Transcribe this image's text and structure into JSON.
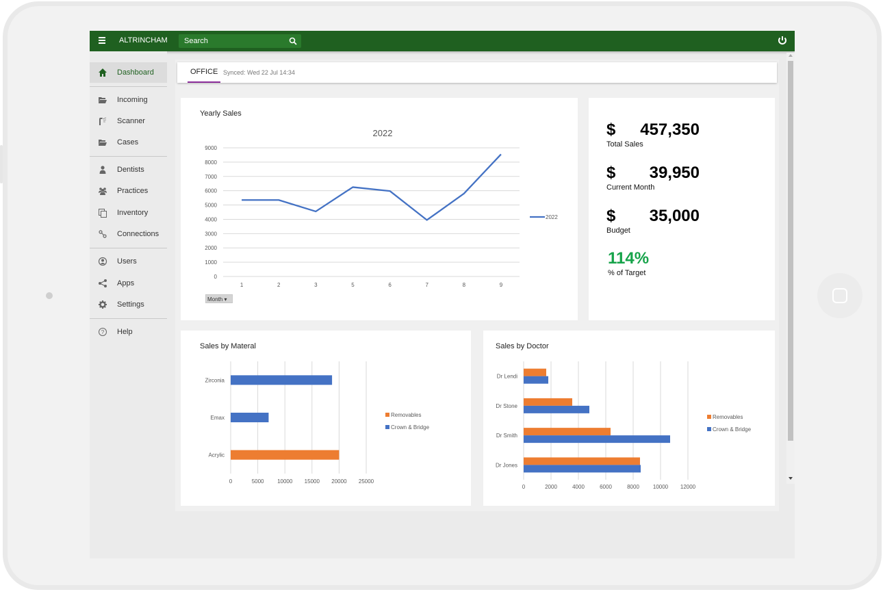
{
  "app": {
    "brand": "ALTRINCHAM",
    "search_placeholder": "Search",
    "icons": {
      "menu": "hamburger-icon",
      "search": "search-icon",
      "power": "power-icon"
    }
  },
  "sidebar": {
    "items": [
      {
        "label": "Dashboard",
        "icon": "home-icon",
        "active": true
      },
      {
        "label": "Incoming",
        "icon": "folder-open-icon"
      },
      {
        "label": "Scanner",
        "icon": "scanner-icon"
      },
      {
        "label": "Cases",
        "icon": "folder-open-icon"
      },
      {
        "label": "Dentists",
        "icon": "user-icon"
      },
      {
        "label": "Practices",
        "icon": "users-icon"
      },
      {
        "label": "Inventory",
        "icon": "copy-icon"
      },
      {
        "label": "Connections",
        "icon": "link-icon"
      },
      {
        "label": "Users",
        "icon": "user-circle-icon"
      },
      {
        "label": "Apps",
        "icon": "share-icon"
      },
      {
        "label": "Settings",
        "icon": "gear-icon"
      },
      {
        "label": "Help",
        "icon": "question-circle-icon"
      }
    ]
  },
  "tabbar": {
    "tab": "OFFICE",
    "synced": "Synced: Wed 22 Jul 14:34"
  },
  "kpis": {
    "currency": "$",
    "total_sales": {
      "value": "457,350",
      "label": "Total Sales"
    },
    "current_month": {
      "value": "39,950",
      "label": "Current Month"
    },
    "budget": {
      "value": "35,000",
      "label": "Budget"
    },
    "target": {
      "value": "114%",
      "label": "% of Target"
    }
  },
  "colors": {
    "brand_green": "#1f6020",
    "series_blue": "#4472c4",
    "series_orange": "#ed7d31",
    "target_green": "#16a34a",
    "tab_underline": "#8a2c9a"
  },
  "chart_data": [
    {
      "type": "line",
      "card_title": "Yearly Sales",
      "title": "2022",
      "categories": [
        "1",
        "2",
        "3",
        "5",
        "6",
        "7",
        "8",
        "9"
      ],
      "series": [
        {
          "name": "2022",
          "values": [
            5350,
            5350,
            4550,
            6250,
            5980,
            3950,
            5800,
            8550
          ]
        }
      ],
      "yticks": [
        0,
        1000,
        2000,
        3000,
        4000,
        5000,
        6000,
        7000,
        8000,
        9000
      ],
      "ylim": [
        0,
        9000
      ],
      "grid": true,
      "legend": "right",
      "filter_button": "Month"
    },
    {
      "type": "bar",
      "orientation": "horizontal",
      "card_title": "Sales by Materal",
      "categories": [
        "Zirconia",
        "Emax",
        "Acrylic"
      ],
      "series": [
        {
          "name": "Removables",
          "values": [
            0,
            0,
            20000
          ]
        },
        {
          "name": "Crown & Bridge",
          "values": [
            18700,
            7000,
            0
          ]
        }
      ],
      "xticks": [
        0,
        5000,
        10000,
        15000,
        20000,
        25000
      ],
      "xlim": [
        0,
        25000
      ],
      "grid": true,
      "legend": "right"
    },
    {
      "type": "bar",
      "orientation": "horizontal",
      "card_title": "Sales by Doctor",
      "categories": [
        "Dr Lendi",
        "Dr Stone",
        "Dr Smith",
        "Dr Jones"
      ],
      "series": [
        {
          "name": "Removables",
          "values": [
            1650,
            3550,
            6350,
            8500
          ]
        },
        {
          "name": "Crown & Bridge",
          "values": [
            1800,
            4800,
            10700,
            8550
          ]
        }
      ],
      "xticks": [
        0,
        2000,
        4000,
        6000,
        8000,
        10000,
        12000
      ],
      "xlim": [
        0,
        12000
      ],
      "grid": true,
      "legend": "right"
    }
  ]
}
